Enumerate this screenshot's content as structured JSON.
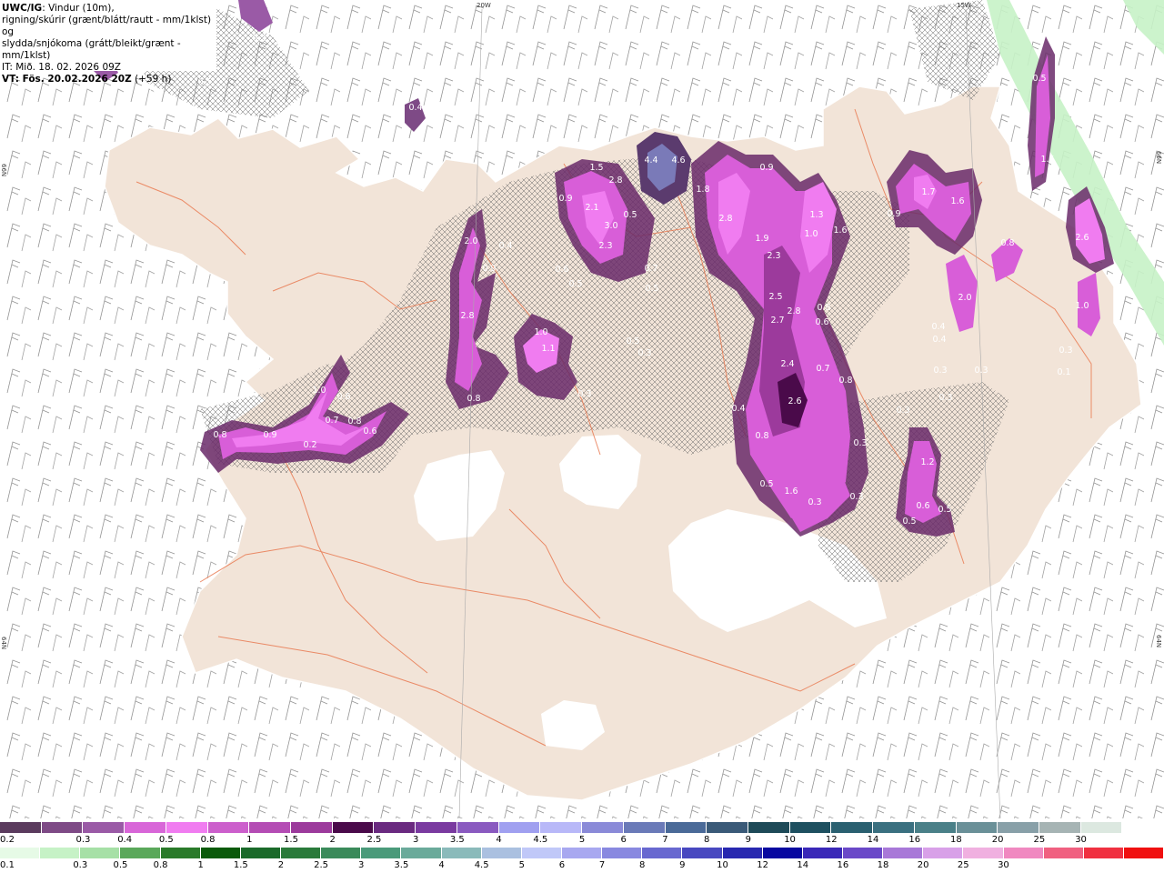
{
  "header": {
    "model": "UWC/IG",
    "line1_rest": ": Vindur (10m),",
    "line2": "rigning/skúrir (grænt/blátt/rautt - mm/1klst) og",
    "line3": "slydda/snjókoma (grátt/bleikt/grænt - mm/1klst)",
    "issue_time": "IT: Mið. 18. 02. 2026 09Z",
    "valid_label": "VT: Fös. 20.02.2026 20Z",
    "lead": "(+59 h)"
  },
  "coords": {
    "top_20w": "20W",
    "top_15w": "15W",
    "left_66n": "66N",
    "right_66n": "66N",
    "left_64n": "64N",
    "right_64n": "64N"
  },
  "colors": {
    "ocean": "#ffffff",
    "land": "#f2e4d8",
    "glacier": "#ffffff",
    "roads": "#e8744a",
    "snow_light": "#9a5a96",
    "snow_mid": "#d85ed8",
    "snow_bright": "#f07cf0",
    "snow_dark": "#6a2a6a",
    "rain_light": "#c6f2c6"
  },
  "precip_labels": [
    {
      "t": "0.4"
    },
    {
      "t": "0.5"
    },
    {
      "t": "0.2"
    },
    {
      "t": "0.4"
    },
    {
      "t": "1.5"
    },
    {
      "t": "0.9"
    },
    {
      "t": "2.1"
    },
    {
      "t": "2.8"
    },
    {
      "t": "3.0"
    },
    {
      "t": "0.5"
    },
    {
      "t": "2.3"
    },
    {
      "t": "4.4"
    },
    {
      "t": "4.6"
    },
    {
      "t": "1.8"
    },
    {
      "t": "2.8"
    },
    {
      "t": "0.9"
    },
    {
      "t": "1.9"
    },
    {
      "t": "2.3"
    },
    {
      "t": "1.3"
    },
    {
      "t": "1.6"
    },
    {
      "t": "1.0"
    },
    {
      "t": "2.0"
    },
    {
      "t": "0.9"
    },
    {
      "t": "0.4"
    },
    {
      "t": "0.6"
    },
    {
      "t": "0.5"
    },
    {
      "t": "0.7"
    },
    {
      "t": "0.5"
    },
    {
      "t": "2.8"
    },
    {
      "t": "1.1"
    },
    {
      "t": "1.0"
    },
    {
      "t": "0.5"
    },
    {
      "t": "0.3"
    },
    {
      "t": "0.3"
    },
    {
      "t": "0.8"
    },
    {
      "t": "1.0"
    },
    {
      "t": "0.6"
    },
    {
      "t": "0.7"
    },
    {
      "t": "0.8"
    },
    {
      "t": "0.6"
    },
    {
      "t": "0.8"
    },
    {
      "t": "0.9"
    },
    {
      "t": "0.2"
    },
    {
      "t": "2.5"
    },
    {
      "t": "2.7"
    },
    {
      "t": "2.8"
    },
    {
      "t": "0.8"
    },
    {
      "t": "0.6"
    },
    {
      "t": "2.4"
    },
    {
      "t": "0.7"
    },
    {
      "t": "0.8"
    },
    {
      "t": "2.6"
    },
    {
      "t": "0.4"
    },
    {
      "t": "0.8"
    },
    {
      "t": "0.3"
    },
    {
      "t": "0.5"
    },
    {
      "t": "1.6"
    },
    {
      "t": "0.3"
    },
    {
      "t": "0.3"
    },
    {
      "t": "1.7"
    },
    {
      "t": "1.6"
    },
    {
      "t": "0.9"
    },
    {
      "t": "0.8"
    },
    {
      "t": "2.0"
    },
    {
      "t": "0.4"
    },
    {
      "t": "0.4"
    },
    {
      "t": "0.3"
    },
    {
      "t": "0.3"
    },
    {
      "t": "0.3"
    },
    {
      "t": "0.3"
    },
    {
      "t": "1.2"
    },
    {
      "t": "0.6"
    },
    {
      "t": "0.5"
    },
    {
      "t": "0.5"
    },
    {
      "t": "0.5"
    },
    {
      "t": "1.5"
    },
    {
      "t": "2.6"
    },
    {
      "t": "1.0"
    },
    {
      "t": "0.3"
    },
    {
      "t": "0.1"
    }
  ],
  "legend": {
    "snow_colors": [
      "#5b3b5e",
      "#7e4a86",
      "#9a5aa6",
      "#d866d8",
      "#f07cf0",
      "#cc5fcc",
      "#b44cb4",
      "#9c3a9c",
      "#4a0a4a",
      "#6a2a80",
      "#7a3aa0",
      "#8a5ac0",
      "#a0a0f0",
      "#b8b8f8",
      "#8a8ad8",
      "#6a7ab8",
      "#4a6a98",
      "#3a5a78",
      "#1e4a58",
      "#1e5060",
      "#2a6070",
      "#3a7080",
      "#4a8088",
      "#6a9098",
      "#88a0a8",
      "#a6b4b4",
      "#dce8e0",
      "#ffffff"
    ],
    "snow_ticks": [
      "0.2",
      "0.3",
      "0.4",
      "0.5",
      "0.8",
      "1",
      "1.5",
      "2",
      "2.5",
      "3",
      "3.5",
      "4",
      "4.5",
      "5",
      "6",
      "7",
      "8",
      "9",
      "10",
      "12",
      "14",
      "16",
      "18",
      "20",
      "25",
      "30"
    ],
    "rain_colors": [
      "#e6fae6",
      "#c6f2c6",
      "#a6e0a6",
      "#5aa85a",
      "#2a7a2a",
      "#0a5a0a",
      "#1a6a2a",
      "#2a7a3a",
      "#3a8a5a",
      "#4a9a7a",
      "#6aaa9a",
      "#8ababa",
      "#aac0e0",
      "#c0c8f8",
      "#a8a8f0",
      "#8888e0",
      "#6868d0",
      "#4848c0",
      "#2828b0",
      "#0808a0",
      "#3a28b8",
      "#6a48c8",
      "#a878d8",
      "#d8a0e8",
      "#f0b0e0",
      "#f088c0",
      "#f06080",
      "#f03040",
      "#f01010"
    ],
    "rain_ticks": [
      "0.1",
      "0.3",
      "0.5",
      "0.8",
      "1",
      "1.5",
      "2",
      "2.5",
      "3",
      "3.5",
      "4",
      "4.5",
      "5",
      "6",
      "7",
      "8",
      "9",
      "10",
      "12",
      "14",
      "16",
      "18",
      "20",
      "25",
      "30"
    ]
  }
}
